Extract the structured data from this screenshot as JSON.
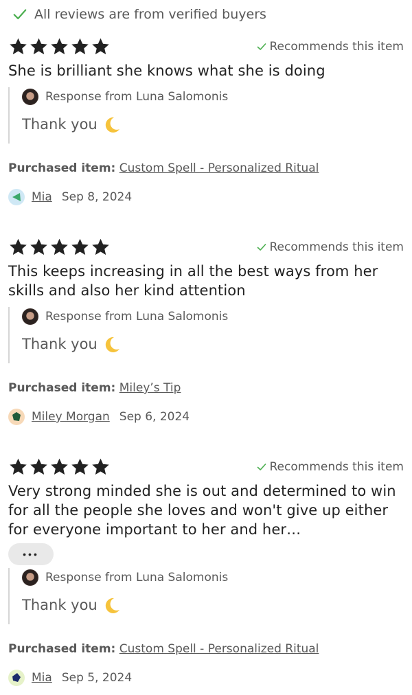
{
  "header": {
    "text": "All reviews are from verified buyers"
  },
  "colors": {
    "check": "#4caf50",
    "star": "#222222",
    "muted": "#595959"
  },
  "reviews": [
    {
      "rating": 5,
      "recommends": "Recommends this item",
      "text": "She is brilliant she knows what she is doing",
      "response_from": "Response from Luna Salomonis",
      "response_text": "Thank you",
      "purchased_label": "Purchased item:",
      "purchased_item": "Custom Spell - Personalized Ritual",
      "buyer": "Mia",
      "date": "Sep 8, 2024",
      "avatar_bg": "#cfe8f5",
      "avatar_shape_color": "#3aa86b"
    },
    {
      "rating": 5,
      "recommends": "Recommends this item",
      "text": "This keeps increasing in all the best ways from her skills and also her kind attention",
      "response_from": "Response from Luna Salomonis",
      "response_text": "Thank you",
      "purchased_label": "Purchased item:",
      "purchased_item": "Miley’s Tip",
      "buyer": "Miley Morgan",
      "date": "Sep 6, 2024",
      "avatar_bg": "#f7d9b8",
      "avatar_shape_color": "#1f5a3a"
    },
    {
      "rating": 5,
      "recommends": "Recommends this item",
      "text": "Very strong minded she is out and determined to win for all the people she loves and won't give up either for everyone important to her and her…",
      "more_label": "•••",
      "response_from": "Response from Luna Salomonis",
      "response_text": "Thank you",
      "purchased_label": "Purchased item:",
      "purchased_item": "Custom Spell - Personalized Ritual",
      "buyer": "Mia",
      "date": "Sep 5, 2024",
      "avatar_bg": "#e6f2c9",
      "avatar_shape_color": "#1b2a6b"
    }
  ]
}
